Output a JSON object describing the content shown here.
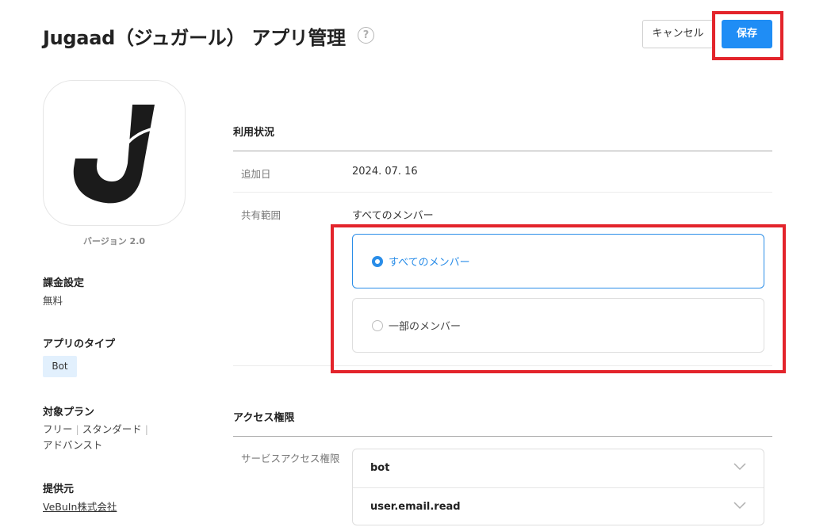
{
  "header": {
    "title": "Jugaad（ジュガール） アプリ管理",
    "help_icon_glyph": "?",
    "cancel_label": "キャンセル",
    "save_label": "保存"
  },
  "app": {
    "icon": "app-logo-j",
    "version": "バージョン 2.0"
  },
  "sidebar": {
    "billing_label": "課金設定",
    "billing_value": "無料",
    "type_label": "アプリのタイプ",
    "type_value": "Bot",
    "plan_label": "対象プラン",
    "plans": [
      "フリー",
      "スタンダード",
      "アドバンスト"
    ],
    "plan_separator": "|",
    "provider_label": "提供元",
    "provider_value": "VeBuIn株式会社"
  },
  "usage": {
    "section_title": "利用状況",
    "added_label": "追加日",
    "added_value": "2024. 07. 16",
    "scope_label": "共有範囲",
    "scope_value": "すべてのメンバー",
    "options": [
      {
        "label": "すべてのメンバー",
        "selected": true
      },
      {
        "label": "一部のメンバー",
        "selected": false
      }
    ]
  },
  "access": {
    "section_title": "アクセス権限",
    "service_label": "サービスアクセス権限",
    "scopes": [
      "bot",
      "user.email.read"
    ]
  },
  "colors": {
    "accent": "#1f8df5",
    "highlight": "#e3242b",
    "badge_bg": "#e2f0fd"
  }
}
